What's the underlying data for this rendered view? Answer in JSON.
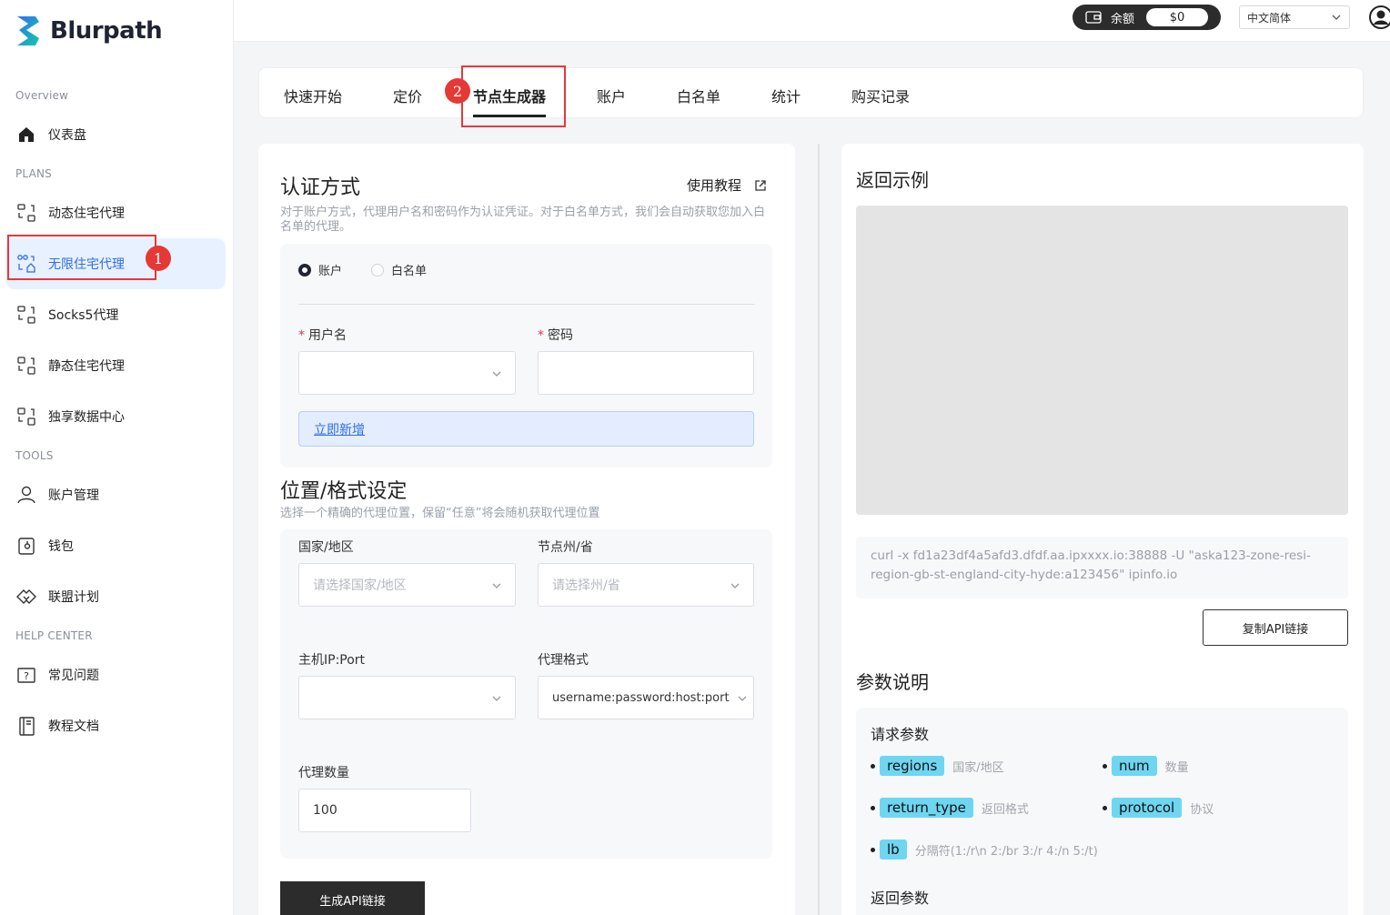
{
  "brand": {
    "name": "Blurpath"
  },
  "sidebar": {
    "sections": {
      "overview": "Overview",
      "plans": "PLANS",
      "tools": "TOOLS",
      "help": "HELP CENTER"
    },
    "items": [
      {
        "label": "仪表盘",
        "icon": "home-icon"
      },
      {
        "label": "动态住宅代理",
        "icon": "proxy-icon"
      },
      {
        "label": "无限住宅代理",
        "icon": "proxy-home-icon"
      },
      {
        "label": "Socks5代理",
        "icon": "proxy-icon"
      },
      {
        "label": "静态住宅代理",
        "icon": "proxy-icon"
      },
      {
        "label": "独享数据中心",
        "icon": "proxy-icon"
      },
      {
        "label": "账户管理",
        "icon": "user-icon"
      },
      {
        "label": "钱包",
        "icon": "wallet-icon"
      },
      {
        "label": "联盟计划",
        "icon": "handshake-icon"
      },
      {
        "label": "常见问题",
        "icon": "question-icon"
      },
      {
        "label": "教程文档",
        "icon": "book-icon"
      }
    ],
    "active_index": 2
  },
  "annotations": {
    "badge1": "1",
    "badge2": "2"
  },
  "header": {
    "balance_label": "余额",
    "balance_value": "$0",
    "language": "中文简体"
  },
  "tabs": [
    "快速开始",
    "定价",
    "节点生成器",
    "账户",
    "白名单",
    "统计",
    "购买记录"
  ],
  "auth": {
    "title": "认证方式",
    "tutorial_link": "使用教程",
    "description": "对于账户方式，代理用户名和密码作为认证凭证。对于白名单方式，我们会自动获取您加入白名单的代理。",
    "radio_account": "账户",
    "radio_whitelist": "白名单",
    "username_label": "用户名",
    "password_label": "密码",
    "add_new": "立即新增"
  },
  "location": {
    "title": "位置/格式设定",
    "description": "选择一个精确的代理位置，保留“任意”将会随机获取代理位置",
    "country_label": "国家/地区",
    "country_placeholder": "请选择国家/地区",
    "state_label": "节点州/省",
    "state_placeholder": "请选择州/省",
    "host_label": "主机IP:Port",
    "format_label": "代理格式",
    "format_value": "username:password:host:port",
    "count_label": "代理数量",
    "count_value": "100",
    "generate_button": "生成API链接"
  },
  "example": {
    "title": "返回示例",
    "curl": "curl -x fd1a23df4a5afd3.dfdf.aa.ipxxxx.io:38888 -U \"aska123-zone-resi-region-gb-st-england-city-hyde:a123456\" ipinfo.io",
    "copy_button": "复制API链接"
  },
  "params": {
    "title": "参数说明",
    "request_title": "请求参数",
    "items": [
      {
        "name": "regions",
        "desc": "国家/地区"
      },
      {
        "name": "num",
        "desc": "数量"
      },
      {
        "name": "return_type",
        "desc": "返回格式"
      },
      {
        "name": "protocol",
        "desc": "协议"
      },
      {
        "name": "lb",
        "desc": "分隔符(1:/r\\n 2:/br 3:/r 4:/n 5:/t)"
      }
    ],
    "return_title": "返回参数"
  },
  "colors": {
    "accent": "#2f6ee8",
    "highlight_red": "#e5383b",
    "chip": "#6ed6f0",
    "dark": "#2c2c2c"
  }
}
